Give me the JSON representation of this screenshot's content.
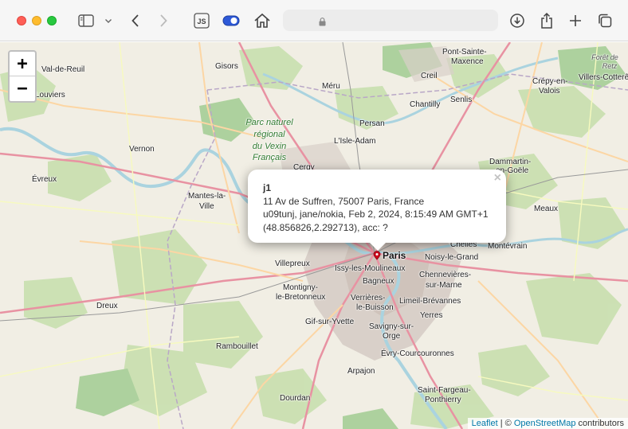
{
  "browser": {
    "toolbar_icons": [
      "sidebar-icon",
      "chevron-down-icon",
      "back-icon",
      "forward-icon",
      "js-icon",
      "toggle-icon",
      "home-icon",
      "lock-icon",
      "download-icon",
      "share-icon",
      "new-tab-icon",
      "tabs-icon"
    ],
    "js_label": "JS"
  },
  "map": {
    "zoom_in": "+",
    "zoom_out": "−",
    "labels": {
      "gisors": "Gisors",
      "val_de_reuil": "Val-de-Reuil",
      "louviers": "Louviers",
      "meru": "Méru",
      "creil": "Creil",
      "senlis": "Senlis",
      "chantilly": "Chantilly",
      "persan": "Persan",
      "lisle_adam": "L'Isle-Adam",
      "vernon": "Vernon",
      "cergy": "Cergy",
      "evreux": "Évreux",
      "mantes": "Mantes-la-",
      "mantes2": "Ville",
      "dammartin": "Dammartin-",
      "dammartin2": "en-Goële",
      "meaux": "Meaux",
      "crepy": "Crépy-en-",
      "crepy2": "Valois",
      "villers": "Villers-Cotterêts",
      "sainte_maxence": "Pont-Sainte-",
      "sainte_maxence2": "Maxence",
      "foret_retz": "Forêt de",
      "foret_retz2": "Retz",
      "paris": "Paris",
      "villepreux": "Villepreux",
      "issy": "Issy-les-Moulineaux",
      "noisy": "Noisy-le-Grand",
      "chelles": "Chelles",
      "montevrain": "Montévrain",
      "bagneux": "Bagneux",
      "chennevieres": "Chennevières-",
      "chennevieres2": "sur-Marne",
      "montigny": "Montigny-",
      "montigny2": "le-Bretonneux",
      "verrieres": "Verrières-",
      "verrieres2": "le-Buisson",
      "limeil": "Limeil-Brévannes",
      "dreux": "Dreux",
      "gif": "Gif-sur-Yvette",
      "yerres": "Yerres",
      "savigny": "Savigny-sur-",
      "savigny2": "Orge",
      "rambouillet": "Rambouillet",
      "evry": "Évry-Courcouronnes",
      "arpajon": "Arpajon",
      "dourdan": "Dourdan",
      "saint_fargeau": "Saint-Fargeau-",
      "saint_fargeau2": "Ponthierry",
      "park1": "Parc naturel",
      "park2": "régional",
      "park3": "du Vexin",
      "park4": "Français"
    },
    "popup": {
      "title": "j1",
      "line1": "11 Av de Suffren, 75007 Paris, France",
      "line2": "u09tunj, jane/nokia, Feb 2, 2024, 8:15:49 AM GMT+1",
      "line3": "(48.856826,2.292713), acc: ?",
      "close": "×"
    },
    "attribution": {
      "leaflet": "Leaflet",
      "sep": " | © ",
      "osm": "OpenStreetMap",
      "suffix": " contributors"
    }
  }
}
